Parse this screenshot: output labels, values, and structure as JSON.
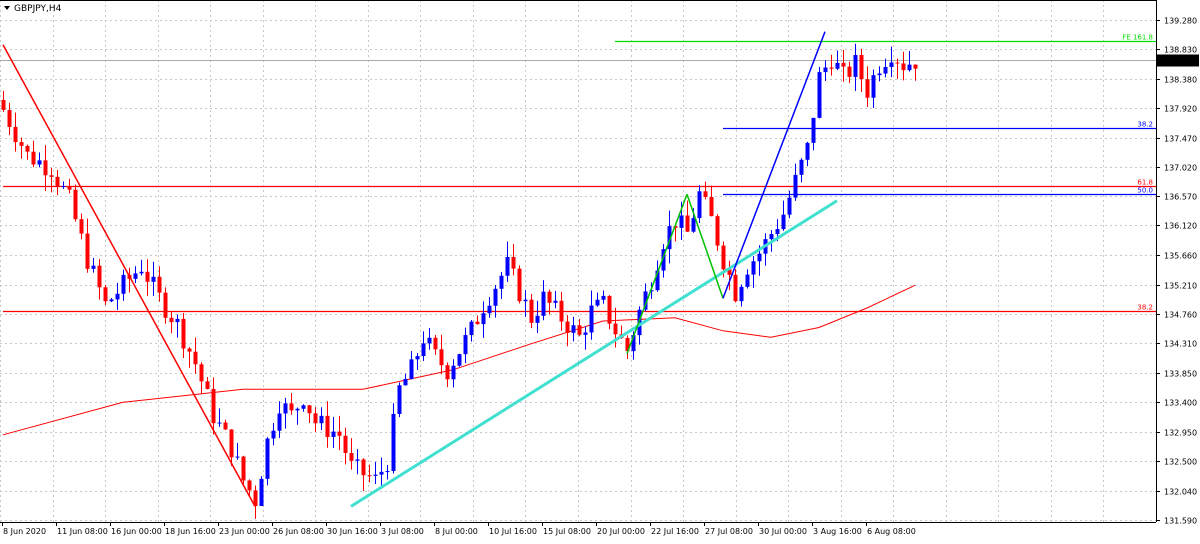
{
  "window": {
    "symbol_title": "GBPJPY,H4"
  },
  "chart_data": {
    "type": "candlestick",
    "symbol": "GBPJPY",
    "timeframe": "H4",
    "ylim": [
      131.59,
      139.28
    ],
    "grid": true,
    "current_price": "138.665",
    "y_ticks": [
      "139.280",
      "138.830",
      "138.380",
      "137.920",
      "137.470",
      "137.020",
      "136.570",
      "136.120",
      "135.660",
      "135.210",
      "134.760",
      "134.310",
      "133.850",
      "133.400",
      "132.950",
      "132.500",
      "132.040",
      "131.590"
    ],
    "x_ticks": [
      "8 Jun 2020",
      "11 Jun 08:00",
      "16 Jun 00:00",
      "18 Jun 16:00",
      "23 Jun 00:00",
      "26 Jun 08:00",
      "30 Jun 16:00",
      "3 Jul 08:00",
      "8 Jul 00:00",
      "10 Jul 16:00",
      "15 Jul 08:00",
      "20 Jul 00:00",
      "22 Jul 16:00",
      "27 Jul 08:00",
      "30 Jul 00:00",
      "3 Aug 16:00",
      "6 Aug 08:00"
    ],
    "close_path": [
      [
        0,
        137.9
      ],
      [
        4,
        137.2
      ],
      [
        8,
        137.0
      ],
      [
        11,
        136.5
      ],
      [
        14,
        135.6
      ],
      [
        17,
        134.9
      ],
      [
        20,
        135.2
      ],
      [
        23,
        135.5
      ],
      [
        26,
        135.0
      ],
      [
        29,
        134.6
      ],
      [
        32,
        134.0
      ],
      [
        35,
        133.2
      ],
      [
        38,
        132.7
      ],
      [
        40,
        132.2
      ],
      [
        42,
        131.9
      ],
      [
        44,
        132.8
      ],
      [
        46,
        133.4
      ],
      [
        48,
        133.2
      ],
      [
        50,
        133.5
      ],
      [
        52,
        133.1
      ],
      [
        54,
        133.0
      ],
      [
        56,
        132.9
      ],
      [
        58,
        132.4
      ],
      [
        60,
        132.3
      ],
      [
        62,
        132.2
      ],
      [
        64,
        132.5
      ],
      [
        66,
        133.6
      ],
      [
        68,
        133.9
      ],
      [
        70,
        134.4
      ],
      [
        72,
        134.1
      ],
      [
        74,
        133.9
      ],
      [
        76,
        134.2
      ],
      [
        78,
        134.5
      ],
      [
        80,
        134.9
      ],
      [
        82,
        135.2
      ],
      [
        84,
        135.5
      ],
      [
        86,
        135.1
      ],
      [
        88,
        134.7
      ],
      [
        90,
        135.0
      ],
      [
        92,
        134.8
      ],
      [
        94,
        134.6
      ],
      [
        96,
        134.4
      ],
      [
        98,
        134.8
      ],
      [
        100,
        134.9
      ],
      [
        102,
        134.5
      ],
      [
        104,
        134.2
      ],
      [
        106,
        134.8
      ],
      [
        108,
        135.3
      ],
      [
        110,
        135.9
      ],
      [
        112,
        136.2
      ],
      [
        114,
        136.0
      ],
      [
        116,
        136.6
      ],
      [
        118,
        136.2
      ],
      [
        120,
        135.6
      ],
      [
        122,
        135.1
      ],
      [
        124,
        135.5
      ],
      [
        126,
        135.7
      ],
      [
        128,
        136.0
      ],
      [
        130,
        136.3
      ],
      [
        132,
        136.8
      ],
      [
        134,
        137.3
      ],
      [
        136,
        138.4
      ],
      [
        138,
        138.7
      ],
      [
        140,
        138.4
      ],
      [
        142,
        138.6
      ],
      [
        144,
        138.2
      ],
      [
        146,
        138.6
      ],
      [
        148,
        138.8
      ],
      [
        150,
        138.6
      ],
      [
        152,
        138.66
      ]
    ],
    "moving_average": [
      [
        0,
        132.9
      ],
      [
        20,
        133.4
      ],
      [
        40,
        133.6
      ],
      [
        60,
        133.6
      ],
      [
        75,
        133.9
      ],
      [
        88,
        134.3
      ],
      [
        100,
        134.65
      ],
      [
        112,
        134.7
      ],
      [
        120,
        134.5
      ],
      [
        128,
        134.4
      ],
      [
        136,
        134.55
      ],
      [
        144,
        134.85
      ],
      [
        152,
        135.2
      ]
    ],
    "trend_lines": [
      {
        "color": "#ff0000",
        "from": [
          0,
          138.9
        ],
        "to": [
          42,
          131.8
        ]
      },
      {
        "color": "#40e0d0",
        "from": [
          58,
          131.8
        ],
        "to": [
          139,
          136.5
        ]
      },
      {
        "color": "#00c000",
        "from": [
          104,
          134.15
        ],
        "to": [
          114,
          136.6
        ]
      },
      {
        "color": "#00c000",
        "from": [
          114,
          136.6
        ],
        "to": [
          120,
          135.0
        ]
      },
      {
        "color": "#0000ff",
        "from": [
          120,
          135.0
        ],
        "to": [
          137,
          139.1
        ]
      }
    ],
    "horizontal_levels": [
      {
        "price": 138.96,
        "label": "FE 161.8",
        "color": "#00dd00",
        "from": 102
      },
      {
        "price": 137.62,
        "label": "38.2",
        "color": "#0000ff",
        "from": 120
      },
      {
        "price": 136.72,
        "label": "61.8",
        "color": "#ff0000",
        "from": 0
      },
      {
        "price": 136.6,
        "label": "50.0",
        "color": "#0000ff",
        "from": 120
      },
      {
        "price": 134.8,
        "label": "38.2",
        "color": "#ff0000",
        "from": 0
      }
    ],
    "colors": {
      "bull_candle": "#0000ff",
      "bear_candle": "#ff0000",
      "moving_average": "#ff0000",
      "current_price_line": "#aaaaaa",
      "grid": "#c8c8c8"
    }
  }
}
